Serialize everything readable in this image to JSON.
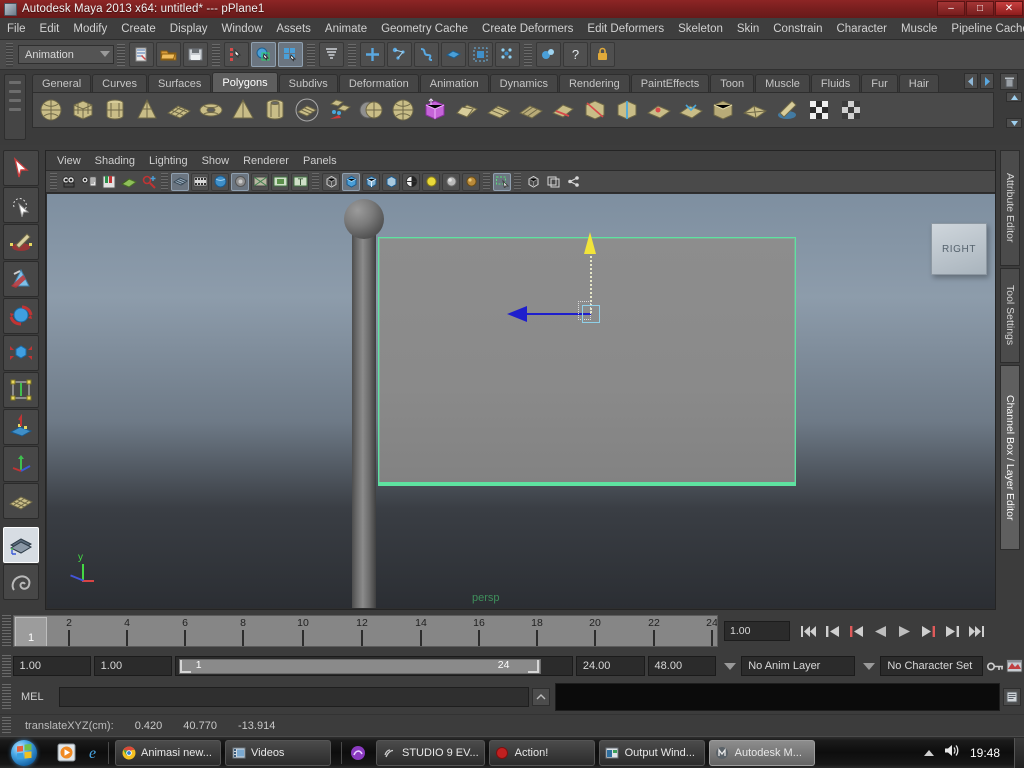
{
  "window": {
    "title": "Autodesk Maya 2013 x64: untitled*  ---  pPlane1",
    "icon": "maya-app-icon",
    "minimize": "–",
    "maximize": "□",
    "close": "✕"
  },
  "menubar": {
    "items": [
      "File",
      "Edit",
      "Modify",
      "Create",
      "Display",
      "Window",
      "Assets",
      "Animate",
      "Geometry Cache",
      "Create Deformers",
      "Edit Deformers",
      "Skeleton",
      "Skin",
      "Constrain",
      "Character",
      "Muscle",
      "Pipeline Cache"
    ],
    "overflow": "»"
  },
  "statusbar": {
    "mode": "Animation",
    "mode_arrow": "chevron-down-icon",
    "buttons": [
      {
        "name": "new-scene-icon"
      },
      {
        "name": "open-scene-icon"
      },
      {
        "name": "save-scene-icon"
      },
      {
        "name": "select-by-hierarchy-icon"
      },
      {
        "name": "select-by-object-icon"
      },
      {
        "name": "select-by-component-icon"
      },
      {
        "name": "highlight-selection-icon"
      },
      {
        "name": "snap-to-grid-icon"
      },
      {
        "name": "snap-to-curve-icon"
      },
      {
        "name": "snap-to-point-icon"
      },
      {
        "name": "snap-to-plane-icon"
      },
      {
        "name": "snap-to-view-plane-icon"
      },
      {
        "name": "make-live-icon"
      },
      {
        "name": "construction-history-icon"
      },
      {
        "name": "render-icon"
      },
      {
        "name": "help-icon"
      },
      {
        "name": "lock-icon"
      }
    ]
  },
  "shelf": {
    "tabs": [
      "General",
      "Curves",
      "Surfaces",
      "Polygons",
      "Subdivs",
      "Deformation",
      "Animation",
      "Dynamics",
      "Rendering",
      "PaintEffects",
      "Toon",
      "Muscle",
      "Fluids",
      "Fur",
      "Hair"
    ],
    "active_tab": "Polygons",
    "nav_prev": "◀",
    "nav_next": "▶",
    "trash": "trash-icon",
    "items": [
      {
        "name": "poly-sphere-icon",
        "glyph": "sphere"
      },
      {
        "name": "poly-cube-icon",
        "glyph": "cube"
      },
      {
        "name": "poly-cylinder-icon",
        "glyph": "cylinder"
      },
      {
        "name": "poly-cone-icon",
        "glyph": "cone"
      },
      {
        "name": "poly-plane-icon",
        "glyph": "plane"
      },
      {
        "name": "poly-torus-icon",
        "glyph": "torus"
      },
      {
        "name": "poly-pyramid-icon",
        "glyph": "pyramid"
      },
      {
        "name": "poly-pipe-icon",
        "glyph": "pipe"
      },
      {
        "name": "poly-prism-icon",
        "glyph": "disc"
      },
      {
        "name": "poly-combine-icon",
        "glyph": "combine"
      },
      {
        "name": "poly-boolean-icon",
        "glyph": "sphere"
      },
      {
        "name": "poly-smooth-icon",
        "glyph": "sphere"
      },
      {
        "name": "poly-extrude-icon",
        "glyph": "magenta-cube"
      },
      {
        "name": "poly-bevel-icon",
        "glyph": "wedge"
      },
      {
        "name": "poly-bridge-icon",
        "glyph": "plane"
      },
      {
        "name": "poly-append-icon",
        "glyph": "plane"
      },
      {
        "name": "poly-split-icon",
        "glyph": "wedge"
      },
      {
        "name": "poly-cut-icon",
        "glyph": "cube"
      },
      {
        "name": "poly-insert-edge-icon",
        "glyph": "cube"
      },
      {
        "name": "poly-merge-icon",
        "glyph": "plane"
      },
      {
        "name": "poly-collapse-icon",
        "glyph": "plane"
      },
      {
        "name": "poly-crease-icon",
        "glyph": "cube"
      },
      {
        "name": "poly-triangulate-icon",
        "glyph": "plane"
      },
      {
        "name": "poly-sculpt-icon",
        "glyph": "paint"
      },
      {
        "name": "poly-uv-checker-icon",
        "glyph": "checker"
      },
      {
        "name": "poly-uv-layout-icon",
        "glyph": "checker"
      }
    ]
  },
  "toolbox": {
    "items": [
      {
        "name": "select-tool",
        "label": "Select Tool",
        "selected": false
      },
      {
        "name": "lasso-select-tool",
        "label": "Lasso Select Tool",
        "selected": false
      },
      {
        "name": "paint-select-tool",
        "label": "Paint Select Tool",
        "selected": false
      },
      {
        "name": "move-tool",
        "label": "Move Tool",
        "selected": false
      },
      {
        "name": "rotate-tool",
        "label": "Rotate Tool",
        "selected": false
      },
      {
        "name": "scale-tool",
        "label": "Scale Tool",
        "selected": false
      },
      {
        "name": "universal-manipulator-tool",
        "label": "Universal Manipulator",
        "selected": false
      },
      {
        "name": "soft-modification-tool",
        "label": "Soft Modification Tool",
        "selected": false
      },
      {
        "name": "show-manipulator-tool",
        "label": "Show Manipulator Tool",
        "selected": false
      },
      {
        "name": "last-tool-used",
        "label": "Last Tool Used",
        "selected": false
      },
      {
        "name": "layout-single-perspective",
        "label": "Single Perspective View",
        "selected": true
      },
      {
        "name": "layout-persp-outliner",
        "label": "Persp / Outliner",
        "selected": false
      }
    ]
  },
  "viewport_panel": {
    "menus": [
      "View",
      "Shading",
      "Lighting",
      "Show",
      "Renderer",
      "Panels"
    ],
    "toolbar_icons": [
      {
        "name": "select-camera-icon"
      },
      {
        "name": "camera-attributes-icon"
      },
      {
        "name": "bookmark-icon"
      },
      {
        "name": "image-plane-icon"
      },
      {
        "name": "two-d-pan-zoom-icon"
      },
      {
        "name": "grid-toggle-icon"
      },
      {
        "name": "film-gate-icon"
      },
      {
        "name": "resolution-gate-icon"
      },
      {
        "name": "gate-mask-icon"
      },
      {
        "name": "field-chart-icon"
      },
      {
        "name": "safe-action-icon"
      },
      {
        "name": "safe-title-icon"
      },
      {
        "name": "wireframe-icon"
      },
      {
        "name": "smooth-shade-all-icon"
      },
      {
        "name": "smooth-shade-selected-icon"
      },
      {
        "name": "flat-shade-icon"
      },
      {
        "name": "texture-toggle-icon"
      },
      {
        "name": "use-default-light-icon"
      },
      {
        "name": "use-all-lights-icon"
      },
      {
        "name": "shadows-icon"
      },
      {
        "name": "xray-toggle-icon"
      },
      {
        "name": "isolate-select-icon"
      },
      {
        "name": "xray-joints-icon"
      },
      {
        "name": "xray-active-components-icon"
      },
      {
        "name": "exposure-icon"
      }
    ],
    "view_cube_label": "RIGHT",
    "camera_label": "persp",
    "axis_label_y": "y",
    "scene_objects": [
      {
        "name": "lamp-post-ball",
        "type": "sphere"
      },
      {
        "name": "lamp-post-shaft",
        "type": "cylinder"
      },
      {
        "name": "selected-plane",
        "type": "pPlane1",
        "selected": true
      }
    ],
    "manipulator": {
      "name": "move-manipulator",
      "axis_y_color": "#f2e43a",
      "axis_x_color": "#1e1ecd"
    }
  },
  "right_tabs": [
    {
      "label": "Attribute Editor",
      "active": false
    },
    {
      "label": "Tool Settings",
      "active": false
    },
    {
      "label": "Channel Box / Layer Editor",
      "active": true
    }
  ],
  "timeline": {
    "current_frame": "1",
    "tick_labels": [
      "2",
      "4",
      "6",
      "8",
      "10",
      "12",
      "14",
      "16",
      "18",
      "20",
      "22",
      "24"
    ],
    "frame_field": "1.00",
    "playback_buttons": [
      {
        "name": "go-to-start-button",
        "glyph": "|◀◀"
      },
      {
        "name": "step-back-frame-button",
        "glyph": "|◀"
      },
      {
        "name": "step-back-key-button",
        "glyph": "|◀"
      },
      {
        "name": "play-backwards-button",
        "glyph": "◀"
      },
      {
        "name": "play-forwards-button",
        "glyph": "▶"
      },
      {
        "name": "step-forward-key-button",
        "glyph": "▶|"
      },
      {
        "name": "step-forward-frame-button",
        "glyph": "▶|"
      },
      {
        "name": "go-to-end-button",
        "glyph": "▶▶|"
      }
    ]
  },
  "range_slider": {
    "anim_start": "1.00",
    "range_start": "1.00",
    "bar_start": "1",
    "bar_end": "24",
    "range_end": "24.00",
    "anim_end": "48.00",
    "anim_layer": "No Anim Layer",
    "character_set": "No Character Set",
    "auto_key_icon": "key-icon",
    "anim_prefs_icon": "animation-preferences-icon"
  },
  "command_line": {
    "language": "MEL",
    "input_value": "",
    "output_value": "",
    "script_editor_icon": "script-editor-icon"
  },
  "help_line": {
    "label": "translateXYZ(cm):",
    "x": "0.420",
    "y": "40.770",
    "z": "-13.914"
  },
  "taskbar": {
    "start": "windows-start-orb",
    "quick_launch": [
      {
        "name": "media-player-icon"
      },
      {
        "name": "internet-explorer-icon"
      }
    ],
    "items": [
      {
        "name": "taskbar-item-chrome",
        "label": "Animasi new...",
        "icon": "chrome-icon",
        "active": false
      },
      {
        "name": "taskbar-item-videos",
        "label": "Videos",
        "icon": "folder-video-icon",
        "active": false
      },
      {
        "name": "taskbar-item-studio9",
        "label": "STUDIO 9 EV...",
        "icon": "studio-icon",
        "active": false
      },
      {
        "name": "taskbar-item-action",
        "label": "Action!",
        "icon": "record-icon",
        "active": false
      },
      {
        "name": "taskbar-item-output",
        "label": "Output Wind...",
        "icon": "output-window-icon",
        "active": false
      },
      {
        "name": "taskbar-item-maya",
        "label": "Autodesk M...",
        "icon": "maya-icon",
        "active": true
      }
    ],
    "tray": {
      "show_hidden": "▲",
      "volume": "volume-icon",
      "clock": "19:48"
    }
  },
  "colors": {
    "title_red": "#7a1f1f",
    "selection_green": "#5ee2a0",
    "manip_y": "#f2e43a",
    "manip_x": "#1e1ecd",
    "panel_gray": "#3c3c3c"
  }
}
